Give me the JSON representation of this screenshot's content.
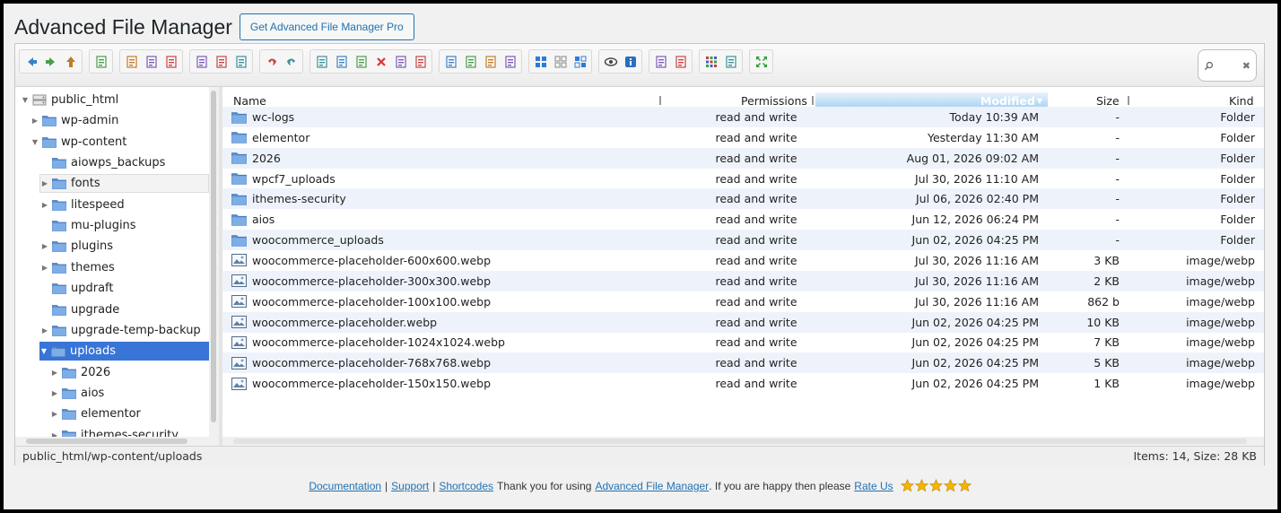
{
  "header": {
    "title": "Advanced File Manager",
    "pro_button": "Get Advanced File Manager Pro"
  },
  "toolbar": {
    "groups": [
      [
        "back-icon",
        "forward-icon",
        "up-icon"
      ],
      [
        "reload-icon"
      ],
      [
        "new-folder-icon",
        "new-file-icon",
        "save-icon"
      ],
      [
        "open-icon",
        "download-icon",
        "select-icon"
      ],
      [
        "undo-icon",
        "redo-icon"
      ],
      [
        "copy-icon",
        "cut-icon",
        "paste-icon",
        "delete-icon",
        "empty-icon",
        "duplicate-icon"
      ],
      [
        "rename-icon",
        "edit-icon",
        "text-edit-icon",
        "archive-icon"
      ],
      [
        "select-all-icon",
        "select-none-icon",
        "invert-select-icon"
      ],
      [
        "preview-icon",
        "info-icon"
      ],
      [
        "extract-icon",
        "compress-icon"
      ],
      [
        "icons-view-icon",
        "list-view-icon"
      ],
      [
        "fullscreen-icon"
      ]
    ],
    "search_placeholder": ""
  },
  "tree": {
    "items": [
      {
        "label": "public_html",
        "depth": 0,
        "arrow": "open",
        "kind": "root"
      },
      {
        "label": "wp-admin",
        "depth": 1,
        "arrow": "closed"
      },
      {
        "label": "wp-content",
        "depth": 1,
        "arrow": "open"
      },
      {
        "label": "aiowps_backups",
        "depth": 2,
        "arrow": "none"
      },
      {
        "label": "fonts",
        "depth": 2,
        "arrow": "closed",
        "state": "hover"
      },
      {
        "label": "litespeed",
        "depth": 2,
        "arrow": "closed"
      },
      {
        "label": "mu-plugins",
        "depth": 2,
        "arrow": "none"
      },
      {
        "label": "plugins",
        "depth": 2,
        "arrow": "closed"
      },
      {
        "label": "themes",
        "depth": 2,
        "arrow": "closed"
      },
      {
        "label": "updraft",
        "depth": 2,
        "arrow": "none"
      },
      {
        "label": "upgrade",
        "depth": 2,
        "arrow": "none"
      },
      {
        "label": "upgrade-temp-backup",
        "depth": 2,
        "arrow": "closed"
      },
      {
        "label": "uploads",
        "depth": 2,
        "arrow": "open",
        "state": "selected"
      },
      {
        "label": "2026",
        "depth": 3,
        "arrow": "closed"
      },
      {
        "label": "aios",
        "depth": 3,
        "arrow": "closed"
      },
      {
        "label": "elementor",
        "depth": 3,
        "arrow": "closed"
      },
      {
        "label": "ithemes-security",
        "depth": 3,
        "arrow": "closed"
      }
    ]
  },
  "list": {
    "columns": {
      "name": "Name",
      "permissions": "Permissions",
      "modified": "Modified",
      "size": "Size",
      "kind": "Kind"
    },
    "rows": [
      {
        "name": "wc-logs",
        "type": "folder",
        "perm": "read and write",
        "modified": "Today 10:39 AM",
        "size": "-",
        "kind": "Folder"
      },
      {
        "name": "elementor",
        "type": "folder",
        "perm": "read and write",
        "modified": "Yesterday 11:30 AM",
        "size": "-",
        "kind": "Folder"
      },
      {
        "name": "2026",
        "type": "folder",
        "perm": "read and write",
        "modified": "Aug 01, 2026 09:02 AM",
        "size": "-",
        "kind": "Folder"
      },
      {
        "name": "wpcf7_uploads",
        "type": "folder",
        "perm": "read and write",
        "modified": "Jul 30, 2026 11:10 AM",
        "size": "-",
        "kind": "Folder"
      },
      {
        "name": "ithemes-security",
        "type": "folder",
        "perm": "read and write",
        "modified": "Jul 06, 2026 02:40 PM",
        "size": "-",
        "kind": "Folder"
      },
      {
        "name": "aios",
        "type": "folder",
        "perm": "read and write",
        "modified": "Jun 12, 2026 06:24 PM",
        "size": "-",
        "kind": "Folder"
      },
      {
        "name": "woocommerce_uploads",
        "type": "folder",
        "perm": "read and write",
        "modified": "Jun 02, 2026 04:25 PM",
        "size": "-",
        "kind": "Folder"
      },
      {
        "name": "woocommerce-placeholder-600x600.webp",
        "type": "image",
        "perm": "read and write",
        "modified": "Jul 30, 2026 11:16 AM",
        "size": "3 KB",
        "kind": "image/webp"
      },
      {
        "name": "woocommerce-placeholder-300x300.webp",
        "type": "image",
        "perm": "read and write",
        "modified": "Jul 30, 2026 11:16 AM",
        "size": "2 KB",
        "kind": "image/webp"
      },
      {
        "name": "woocommerce-placeholder-100x100.webp",
        "type": "image",
        "perm": "read and write",
        "modified": "Jul 30, 2026 11:16 AM",
        "size": "862 b",
        "kind": "image/webp"
      },
      {
        "name": "woocommerce-placeholder.webp",
        "type": "image",
        "perm": "read and write",
        "modified": "Jun 02, 2026 04:25 PM",
        "size": "10 KB",
        "kind": "image/webp"
      },
      {
        "name": "woocommerce-placeholder-1024x1024.webp",
        "type": "image",
        "perm": "read and write",
        "modified": "Jun 02, 2026 04:25 PM",
        "size": "7 KB",
        "kind": "image/webp"
      },
      {
        "name": "woocommerce-placeholder-768x768.webp",
        "type": "image",
        "perm": "read and write",
        "modified": "Jun 02, 2026 04:25 PM",
        "size": "5 KB",
        "kind": "image/webp"
      },
      {
        "name": "woocommerce-placeholder-150x150.webp",
        "type": "image",
        "perm": "read and write",
        "modified": "Jun 02, 2026 04:25 PM",
        "size": "1 KB",
        "kind": "image/webp"
      }
    ]
  },
  "status": {
    "path": "public_html/wp-content/uploads",
    "summary": "Items: 14, Size: 28 KB"
  },
  "footer": {
    "documentation": "Documentation",
    "support": "Support",
    "shortcodes": "Shortcodes",
    "thanks": "Thank you for using",
    "plugin_link": "Advanced File Manager",
    "happy": ". If you are happy then please",
    "rate_us": "Rate Us",
    "sep": "|",
    "star_count": 5
  },
  "colors": {
    "accent": "#2271b1",
    "selected": "#3875d7",
    "folder": "#5b8fd1",
    "star": "#f5b400"
  }
}
